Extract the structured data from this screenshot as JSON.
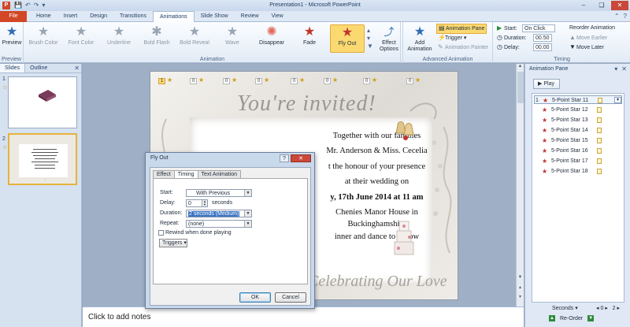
{
  "window": {
    "title": "Presentation1 - Microsoft PowerPoint",
    "app_icon": "P",
    "colors": {
      "file_tab": "#d24726",
      "selected": "#fbd971",
      "close": "#c9483a"
    }
  },
  "quick_access": [
    "save-icon",
    "undo-icon",
    "redo-icon",
    "customize-icon"
  ],
  "tabs": {
    "file": "File",
    "items": [
      "Home",
      "Insert",
      "Design",
      "Transitions",
      "Animations",
      "Slide Show",
      "Review",
      "View"
    ],
    "active": "Animations"
  },
  "ribbon": {
    "preview_group": {
      "button": "Preview",
      "label": "Preview"
    },
    "animation_group": {
      "label": "Animation",
      "effects": [
        "Brush Color",
        "Font Color",
        "Underline",
        "Bold Flash",
        "Bold Reveal",
        "Wave",
        "Disappear",
        "Fade",
        "Fly Out"
      ],
      "selected": "Fly Out",
      "effect_options": "Effect Options"
    },
    "advanced_group": {
      "label": "Advanced Animation",
      "add_animation": "Add Animation",
      "animation_pane": "Animation Pane",
      "trigger": "Trigger",
      "animation_painter": "Animation Painter"
    },
    "timing_group": {
      "label": "Timing",
      "start_label": "Start:",
      "start_value": "On Click",
      "duration_label": "Duration:",
      "duration_value": "00.50",
      "delay_label": "Delay:",
      "delay_value": "00.00",
      "reorder_label": "Reorder Animation",
      "move_earlier": "Move Earlier",
      "move_later": "Move Later"
    }
  },
  "left_pane": {
    "tabs": [
      "Slides",
      "Outline"
    ],
    "slides": [
      {
        "number": "1",
        "has_animation": true
      },
      {
        "number": "2",
        "has_animation": true
      }
    ]
  },
  "slide": {
    "invited": "You're invited!",
    "lines": [
      "Together with our families",
      "Mr. Anderson & Miss. Cecelia",
      "t the honour of your presence",
      "at their wedding  on",
      "y, 17th June 2014 at 11 am",
      "Chenies Manor House in",
      "Buckinghamshire",
      "inner and dance to follow"
    ],
    "footer": "Celebrating Our Love",
    "anim_tags": [
      "1",
      "0",
      "0",
      "0",
      "0",
      "0",
      "0",
      "0"
    ]
  },
  "notes": {
    "placeholder": "Click to add notes"
  },
  "animation_pane": {
    "title": "Animation Pane",
    "play": "Play",
    "items": [
      {
        "num": "1",
        "label": "5-Point Star 11"
      },
      {
        "num": "",
        "label": "5-Point Star 12"
      },
      {
        "num": "",
        "label": "5-Point Star 13"
      },
      {
        "num": "",
        "label": "5-Point Star 14"
      },
      {
        "num": "",
        "label": "5-Point Star 15"
      },
      {
        "num": "",
        "label": "5-Point Star 16"
      },
      {
        "num": "",
        "label": "5-Point Star 17"
      },
      {
        "num": "",
        "label": "5-Point Star 18"
      }
    ],
    "seconds": "Seconds",
    "timeline_start": "0",
    "timeline_end": "2",
    "reorder": "Re-Order"
  },
  "dialog": {
    "title": "Fly Out",
    "tabs": [
      "Effect",
      "Timing",
      "Text Animation"
    ],
    "active_tab": "Timing",
    "start_label": "Start:",
    "start_value": "With Previous",
    "delay_label": "Delay:",
    "delay_value": "0",
    "delay_unit": "seconds",
    "duration_label": "Duration:",
    "duration_value": "2 seconds (Medium)",
    "repeat_label": "Repeat:",
    "repeat_value": "(none)",
    "rewind_label": "Rewind when done playing",
    "triggers": "Triggers",
    "ok": "OK",
    "cancel": "Cancel"
  }
}
